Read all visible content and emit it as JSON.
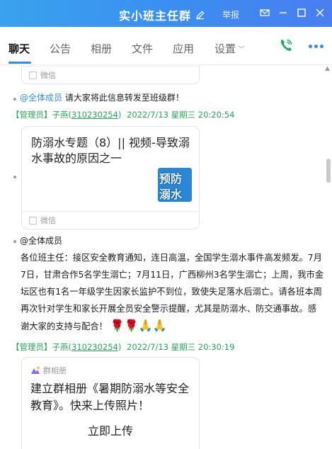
{
  "titlebar": {
    "title": "实小班主任群",
    "report_label": "举报"
  },
  "tabs": [
    {
      "label": "聊天",
      "active": true
    },
    {
      "label": "公告"
    },
    {
      "label": "相册"
    },
    {
      "label": "文件"
    },
    {
      "label": "应用"
    },
    {
      "label": "设置"
    }
  ],
  "colors": {
    "accent": "#2d8cf0",
    "sender_meta": "#27a25d",
    "titlebar": "#3a8ff0"
  },
  "messages": {
    "card_top": {
      "footer": "微信"
    },
    "forward_notice": {
      "mention": "@全体成员",
      "text": "请大家将此信息转发至班级群！"
    },
    "meta_1": {
      "role": "【管理员】",
      "name": "子燕(",
      "qq": "310230254",
      "close": ")",
      "time": "2022/7/13 星期三 20:20:54"
    },
    "video_card": {
      "title": "防溺水专题（8）|| 视频-导致溺水事故的原因之一",
      "thumb_text": [
        "预防",
        "溺水"
      ],
      "footer": "微信"
    },
    "notice": {
      "mention": "@全体成员",
      "text": "各位班主任：接区安全教育通知，连日高温，全国学生溺水事件高发频发。7月7日，甘肃合作5名学生溺亡；7月11日，广西柳州3名学生溺亡；上周，我市金坛区也有1名一年级学生因家长监护不到位，致使失足落水后溺亡。请各班本周再次针对学生和家长开展全员安全警示提醒，尤其是防溺水、防交通事故。感谢大家的支持与配合！",
      "emojis": "🌹🌹🙏🙏"
    },
    "meta_2": {
      "role": "【管理员】",
      "name": "子燕(",
      "qq": "310230254",
      "close": ")",
      "time": "2022/7/13 星期三 20:30:19"
    },
    "album_card": {
      "source": "群相册",
      "title": "建立群相册《暑期防溺水等安全教育》。快来上传照片！",
      "button": "立即上传"
    }
  }
}
